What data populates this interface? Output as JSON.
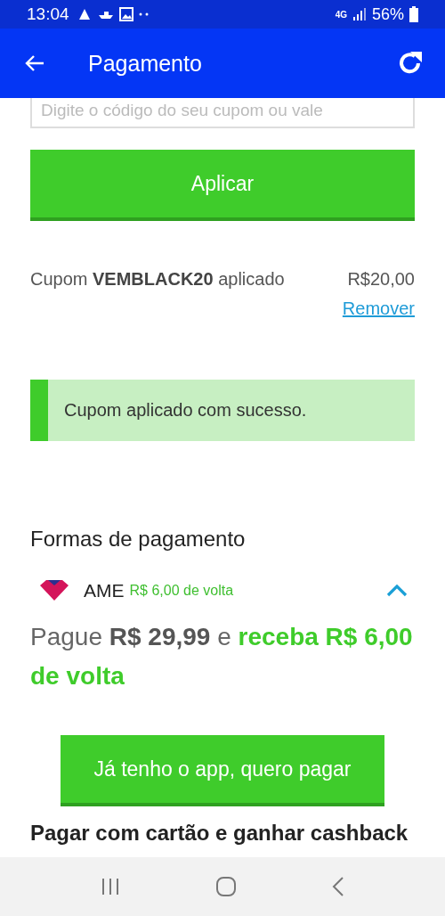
{
  "status_bar": {
    "time": "13:04",
    "network": "4G",
    "battery": "56%"
  },
  "app_bar": {
    "title": "Pagamento"
  },
  "coupon_field": {
    "placeholder": "Digite o código do seu cupom ou vale"
  },
  "apply_button": "Aplicar",
  "applied_coupon": {
    "text": "Cupom **VEMBLACK20** aplicado",
    "amount": "R$20,00",
    "remove_link": "Remover"
  },
  "success_message": "Cupom aplicado com sucesso.",
  "payment_section": {
    "title": "Formas de pagamento",
    "methods": [
      {
        "name": "AME",
        "cashback": "R$ 6,00 de volta",
        "expanded": true,
        "description": [
          {
            "kind": "plain",
            "text": "Pague "
          },
          {
            "kind": "amount",
            "text": "R$ 29,99"
          },
          {
            "kind": "plain",
            "text": " e "
          },
          {
            "kind": "highlight",
            "text": "receba R$ 6,00 de volta"
          }
        ],
        "button": "Já tenho o app, quero pagar"
      }
    ],
    "next_option": "Pagar com cartão e ganhar cashback"
  }
}
